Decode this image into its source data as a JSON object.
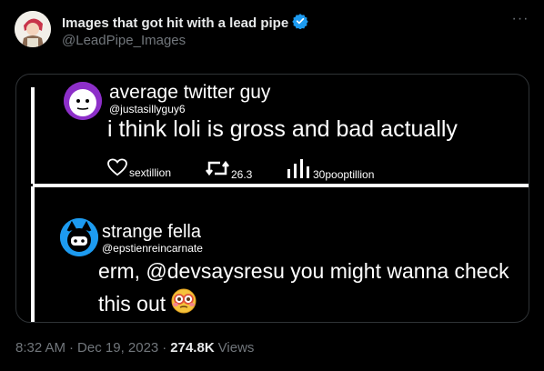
{
  "author": {
    "name": "Images that got hit with a lead pipe",
    "handle": "@LeadPipe_Images",
    "verified_color": "#1d9bf0"
  },
  "more_label": "···",
  "media": {
    "post1": {
      "name": "average twitter guy",
      "handle": "@justasillyguy6",
      "text": "i think loli is gross and bad actually",
      "likes": "sextillion",
      "retweets": "26.3",
      "views": "30pooptillion"
    },
    "post2": {
      "name": "strange fella",
      "handle": "@epstienreincarnate",
      "text": "erm, @devsaysresu you might wanna check this out"
    }
  },
  "footer": {
    "time": "8:32 AM",
    "sep1": "·",
    "date": "Dec 19, 2023",
    "sep2": "·",
    "views_count": "274.8K",
    "views_label": "Views"
  }
}
